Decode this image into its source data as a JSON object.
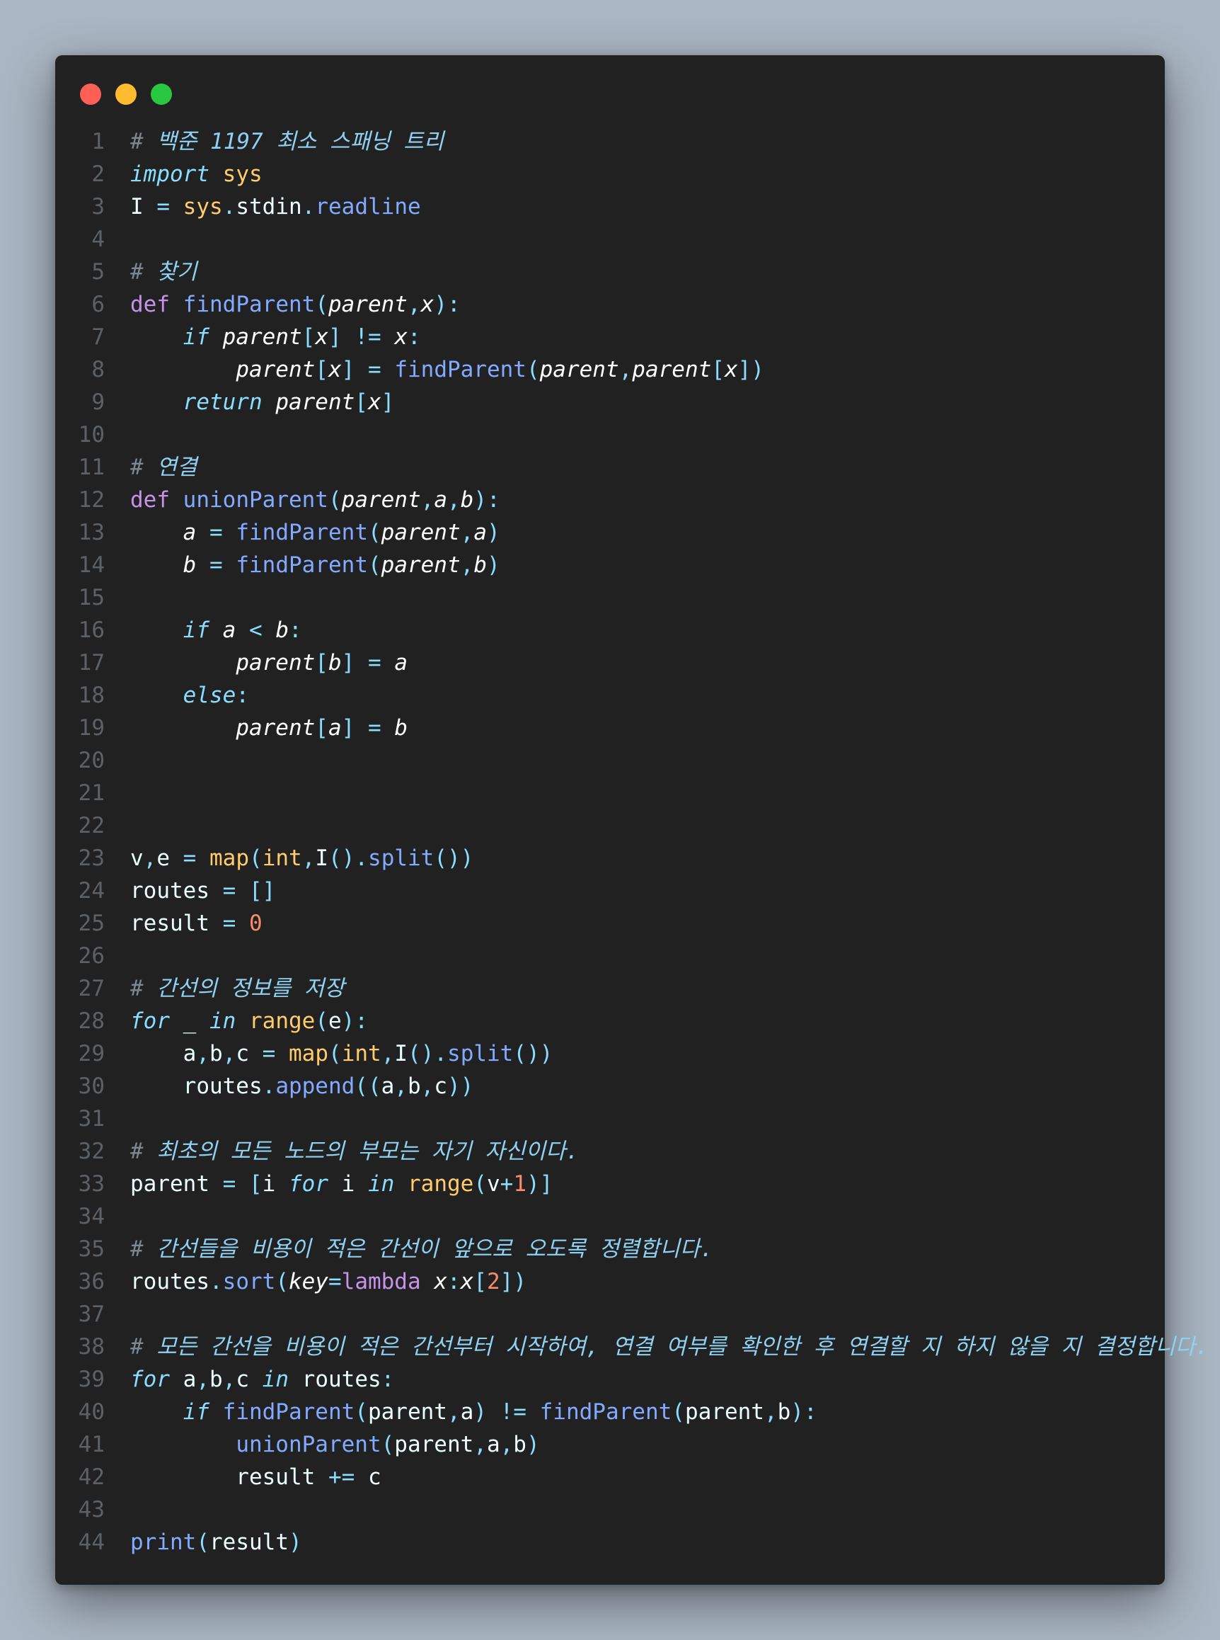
{
  "window_controls": {
    "close_color": "#ff5f57",
    "minimize_color": "#febc2e",
    "maximize_color": "#28c840"
  },
  "code_lines": [
    {
      "n": "1",
      "tokens": [
        {
          "t": "# ",
          "c": "comment"
        },
        {
          "t": "백준 1197 최소 스패닝 트리",
          "c": "ctext"
        }
      ]
    },
    {
      "n": "2",
      "tokens": [
        {
          "t": "import",
          "c": "ctrl"
        },
        {
          "t": " ",
          "c": "plain"
        },
        {
          "t": "sys",
          "c": "builtin"
        }
      ]
    },
    {
      "n": "3",
      "tokens": [
        {
          "t": "I ",
          "c": "plain"
        },
        {
          "t": "=",
          "c": "op"
        },
        {
          "t": " ",
          "c": "plain"
        },
        {
          "t": "sys",
          "c": "builtin"
        },
        {
          "t": ".",
          "c": "op"
        },
        {
          "t": "stdin",
          "c": "plain"
        },
        {
          "t": ".",
          "c": "op"
        },
        {
          "t": "readline",
          "c": "fn"
        }
      ]
    },
    {
      "n": "4",
      "tokens": []
    },
    {
      "n": "5",
      "tokens": [
        {
          "t": "# ",
          "c": "comment"
        },
        {
          "t": "찾기",
          "c": "ctext"
        }
      ]
    },
    {
      "n": "6",
      "tokens": [
        {
          "t": "def",
          "c": "kw"
        },
        {
          "t": " ",
          "c": "plain"
        },
        {
          "t": "findParent",
          "c": "fn"
        },
        {
          "t": "(",
          "c": "op"
        },
        {
          "t": "parent",
          "c": "param"
        },
        {
          "t": ",",
          "c": "op"
        },
        {
          "t": "x",
          "c": "param"
        },
        {
          "t": "):",
          "c": "op"
        }
      ]
    },
    {
      "n": "7",
      "tokens": [
        {
          "t": "    ",
          "c": "plain"
        },
        {
          "t": "if",
          "c": "ctrl"
        },
        {
          "t": " ",
          "c": "plain"
        },
        {
          "t": "parent",
          "c": "param"
        },
        {
          "t": "[",
          "c": "op"
        },
        {
          "t": "x",
          "c": "param"
        },
        {
          "t": "]",
          "c": "op"
        },
        {
          "t": " ",
          "c": "plain"
        },
        {
          "t": "!=",
          "c": "op"
        },
        {
          "t": " ",
          "c": "plain"
        },
        {
          "t": "x",
          "c": "param"
        },
        {
          "t": ":",
          "c": "op"
        }
      ]
    },
    {
      "n": "8",
      "tokens": [
        {
          "t": "        ",
          "c": "plain"
        },
        {
          "t": "parent",
          "c": "param"
        },
        {
          "t": "[",
          "c": "op"
        },
        {
          "t": "x",
          "c": "param"
        },
        {
          "t": "]",
          "c": "op"
        },
        {
          "t": " ",
          "c": "plain"
        },
        {
          "t": "=",
          "c": "op"
        },
        {
          "t": " ",
          "c": "plain"
        },
        {
          "t": "findParent",
          "c": "fn"
        },
        {
          "t": "(",
          "c": "op"
        },
        {
          "t": "parent",
          "c": "param"
        },
        {
          "t": ",",
          "c": "op"
        },
        {
          "t": "parent",
          "c": "param"
        },
        {
          "t": "[",
          "c": "op"
        },
        {
          "t": "x",
          "c": "param"
        },
        {
          "t": "])",
          "c": "op"
        }
      ]
    },
    {
      "n": "9",
      "tokens": [
        {
          "t": "    ",
          "c": "plain"
        },
        {
          "t": "return",
          "c": "ctrl"
        },
        {
          "t": " ",
          "c": "plain"
        },
        {
          "t": "parent",
          "c": "param"
        },
        {
          "t": "[",
          "c": "op"
        },
        {
          "t": "x",
          "c": "param"
        },
        {
          "t": "]",
          "c": "op"
        }
      ]
    },
    {
      "n": "10",
      "tokens": []
    },
    {
      "n": "11",
      "tokens": [
        {
          "t": "# ",
          "c": "comment"
        },
        {
          "t": "연결",
          "c": "ctext"
        }
      ]
    },
    {
      "n": "12",
      "tokens": [
        {
          "t": "def",
          "c": "kw"
        },
        {
          "t": " ",
          "c": "plain"
        },
        {
          "t": "unionParent",
          "c": "fn"
        },
        {
          "t": "(",
          "c": "op"
        },
        {
          "t": "parent",
          "c": "param"
        },
        {
          "t": ",",
          "c": "op"
        },
        {
          "t": "a",
          "c": "param"
        },
        {
          "t": ",",
          "c": "op"
        },
        {
          "t": "b",
          "c": "param"
        },
        {
          "t": "):",
          "c": "op"
        }
      ]
    },
    {
      "n": "13",
      "tokens": [
        {
          "t": "    ",
          "c": "plain"
        },
        {
          "t": "a",
          "c": "param"
        },
        {
          "t": " ",
          "c": "plain"
        },
        {
          "t": "=",
          "c": "op"
        },
        {
          "t": " ",
          "c": "plain"
        },
        {
          "t": "findParent",
          "c": "fn"
        },
        {
          "t": "(",
          "c": "op"
        },
        {
          "t": "parent",
          "c": "param"
        },
        {
          "t": ",",
          "c": "op"
        },
        {
          "t": "a",
          "c": "param"
        },
        {
          "t": ")",
          "c": "op"
        }
      ]
    },
    {
      "n": "14",
      "tokens": [
        {
          "t": "    ",
          "c": "plain"
        },
        {
          "t": "b",
          "c": "param"
        },
        {
          "t": " ",
          "c": "plain"
        },
        {
          "t": "=",
          "c": "op"
        },
        {
          "t": " ",
          "c": "plain"
        },
        {
          "t": "findParent",
          "c": "fn"
        },
        {
          "t": "(",
          "c": "op"
        },
        {
          "t": "parent",
          "c": "param"
        },
        {
          "t": ",",
          "c": "op"
        },
        {
          "t": "b",
          "c": "param"
        },
        {
          "t": ")",
          "c": "op"
        }
      ]
    },
    {
      "n": "15",
      "tokens": []
    },
    {
      "n": "16",
      "tokens": [
        {
          "t": "    ",
          "c": "plain"
        },
        {
          "t": "if",
          "c": "ctrl"
        },
        {
          "t": " ",
          "c": "plain"
        },
        {
          "t": "a",
          "c": "param"
        },
        {
          "t": " ",
          "c": "plain"
        },
        {
          "t": "<",
          "c": "op"
        },
        {
          "t": " ",
          "c": "plain"
        },
        {
          "t": "b",
          "c": "param"
        },
        {
          "t": ":",
          "c": "op"
        }
      ]
    },
    {
      "n": "17",
      "tokens": [
        {
          "t": "        ",
          "c": "plain"
        },
        {
          "t": "parent",
          "c": "param"
        },
        {
          "t": "[",
          "c": "op"
        },
        {
          "t": "b",
          "c": "param"
        },
        {
          "t": "]",
          "c": "op"
        },
        {
          "t": " ",
          "c": "plain"
        },
        {
          "t": "=",
          "c": "op"
        },
        {
          "t": " ",
          "c": "plain"
        },
        {
          "t": "a",
          "c": "param"
        }
      ]
    },
    {
      "n": "18",
      "tokens": [
        {
          "t": "    ",
          "c": "plain"
        },
        {
          "t": "else",
          "c": "ctrl"
        },
        {
          "t": ":",
          "c": "op"
        }
      ]
    },
    {
      "n": "19",
      "tokens": [
        {
          "t": "        ",
          "c": "plain"
        },
        {
          "t": "parent",
          "c": "param"
        },
        {
          "t": "[",
          "c": "op"
        },
        {
          "t": "a",
          "c": "param"
        },
        {
          "t": "]",
          "c": "op"
        },
        {
          "t": " ",
          "c": "plain"
        },
        {
          "t": "=",
          "c": "op"
        },
        {
          "t": " ",
          "c": "plain"
        },
        {
          "t": "b",
          "c": "param"
        }
      ]
    },
    {
      "n": "20",
      "tokens": []
    },
    {
      "n": "21",
      "tokens": []
    },
    {
      "n": "22",
      "tokens": []
    },
    {
      "n": "23",
      "tokens": [
        {
          "t": "v",
          "c": "plain"
        },
        {
          "t": ",",
          "c": "op"
        },
        {
          "t": "e ",
          "c": "plain"
        },
        {
          "t": "=",
          "c": "op"
        },
        {
          "t": " ",
          "c": "plain"
        },
        {
          "t": "map",
          "c": "builtin"
        },
        {
          "t": "(",
          "c": "op"
        },
        {
          "t": "int",
          "c": "builtin"
        },
        {
          "t": ",",
          "c": "op"
        },
        {
          "t": "I",
          "c": "plain"
        },
        {
          "t": "().",
          "c": "op"
        },
        {
          "t": "split",
          "c": "fn"
        },
        {
          "t": "())",
          "c": "op"
        }
      ]
    },
    {
      "n": "24",
      "tokens": [
        {
          "t": "routes ",
          "c": "plain"
        },
        {
          "t": "=",
          "c": "op"
        },
        {
          "t": " ",
          "c": "plain"
        },
        {
          "t": "[]",
          "c": "op"
        }
      ]
    },
    {
      "n": "25",
      "tokens": [
        {
          "t": "result ",
          "c": "plain"
        },
        {
          "t": "=",
          "c": "op"
        },
        {
          "t": " ",
          "c": "plain"
        },
        {
          "t": "0",
          "c": "num"
        }
      ]
    },
    {
      "n": "26",
      "tokens": []
    },
    {
      "n": "27",
      "tokens": [
        {
          "t": "# ",
          "c": "comment"
        },
        {
          "t": "간선의 정보를 저장",
          "c": "ctext"
        }
      ]
    },
    {
      "n": "28",
      "tokens": [
        {
          "t": "for",
          "c": "ctrl"
        },
        {
          "t": " _ ",
          "c": "plain"
        },
        {
          "t": "in",
          "c": "ctrl"
        },
        {
          "t": " ",
          "c": "plain"
        },
        {
          "t": "range",
          "c": "builtin"
        },
        {
          "t": "(",
          "c": "op"
        },
        {
          "t": "e",
          "c": "plain"
        },
        {
          "t": "):",
          "c": "op"
        }
      ]
    },
    {
      "n": "29",
      "tokens": [
        {
          "t": "    a",
          "c": "plain"
        },
        {
          "t": ",",
          "c": "op"
        },
        {
          "t": "b",
          "c": "plain"
        },
        {
          "t": ",",
          "c": "op"
        },
        {
          "t": "c ",
          "c": "plain"
        },
        {
          "t": "=",
          "c": "op"
        },
        {
          "t": " ",
          "c": "plain"
        },
        {
          "t": "map",
          "c": "builtin"
        },
        {
          "t": "(",
          "c": "op"
        },
        {
          "t": "int",
          "c": "builtin"
        },
        {
          "t": ",",
          "c": "op"
        },
        {
          "t": "I",
          "c": "plain"
        },
        {
          "t": "().",
          "c": "op"
        },
        {
          "t": "split",
          "c": "fn"
        },
        {
          "t": "())",
          "c": "op"
        }
      ]
    },
    {
      "n": "30",
      "tokens": [
        {
          "t": "    routes",
          "c": "plain"
        },
        {
          "t": ".",
          "c": "op"
        },
        {
          "t": "append",
          "c": "fn"
        },
        {
          "t": "((",
          "c": "op"
        },
        {
          "t": "a",
          "c": "plain"
        },
        {
          "t": ",",
          "c": "op"
        },
        {
          "t": "b",
          "c": "plain"
        },
        {
          "t": ",",
          "c": "op"
        },
        {
          "t": "c",
          "c": "plain"
        },
        {
          "t": "))",
          "c": "op"
        }
      ]
    },
    {
      "n": "31",
      "tokens": []
    },
    {
      "n": "32",
      "tokens": [
        {
          "t": "# ",
          "c": "comment"
        },
        {
          "t": "최초의 모든 노드의 부모는 자기 자신이다.",
          "c": "ctext"
        }
      ]
    },
    {
      "n": "33",
      "tokens": [
        {
          "t": "parent ",
          "c": "plain"
        },
        {
          "t": "=",
          "c": "op"
        },
        {
          "t": " ",
          "c": "plain"
        },
        {
          "t": "[",
          "c": "op"
        },
        {
          "t": "i ",
          "c": "plain"
        },
        {
          "t": "for",
          "c": "ctrl"
        },
        {
          "t": " i ",
          "c": "plain"
        },
        {
          "t": "in",
          "c": "ctrl"
        },
        {
          "t": " ",
          "c": "plain"
        },
        {
          "t": "range",
          "c": "builtin"
        },
        {
          "t": "(",
          "c": "op"
        },
        {
          "t": "v",
          "c": "plain"
        },
        {
          "t": "+",
          "c": "op"
        },
        {
          "t": "1",
          "c": "num"
        },
        {
          "t": ")]",
          "c": "op"
        }
      ]
    },
    {
      "n": "34",
      "tokens": []
    },
    {
      "n": "35",
      "tokens": [
        {
          "t": "# ",
          "c": "comment"
        },
        {
          "t": "간선들을 비용이 적은 간선이 앞으로 오도록 정렬합니다.",
          "c": "ctext"
        }
      ]
    },
    {
      "n": "36",
      "tokens": [
        {
          "t": "routes",
          "c": "plain"
        },
        {
          "t": ".",
          "c": "op"
        },
        {
          "t": "sort",
          "c": "fn"
        },
        {
          "t": "(",
          "c": "op"
        },
        {
          "t": "key",
          "c": "param"
        },
        {
          "t": "=",
          "c": "op"
        },
        {
          "t": "lambda",
          "c": "kw"
        },
        {
          "t": " ",
          "c": "plain"
        },
        {
          "t": "x",
          "c": "param"
        },
        {
          "t": ":",
          "c": "op"
        },
        {
          "t": "x",
          "c": "param"
        },
        {
          "t": "[",
          "c": "op"
        },
        {
          "t": "2",
          "c": "num"
        },
        {
          "t": "])",
          "c": "op"
        }
      ]
    },
    {
      "n": "37",
      "tokens": []
    },
    {
      "n": "38",
      "tokens": [
        {
          "t": "# ",
          "c": "comment"
        },
        {
          "t": "모든 간선을 비용이 적은 간선부터 시작하여, 연결 여부를 확인한 후 연결할 지 하지 않을 지 결정합니다.",
          "c": "ctext"
        }
      ]
    },
    {
      "n": "39",
      "tokens": [
        {
          "t": "for",
          "c": "ctrl"
        },
        {
          "t": " a",
          "c": "plain"
        },
        {
          "t": ",",
          "c": "op"
        },
        {
          "t": "b",
          "c": "plain"
        },
        {
          "t": ",",
          "c": "op"
        },
        {
          "t": "c ",
          "c": "plain"
        },
        {
          "t": "in",
          "c": "ctrl"
        },
        {
          "t": " routes",
          "c": "plain"
        },
        {
          "t": ":",
          "c": "op"
        }
      ]
    },
    {
      "n": "40",
      "tokens": [
        {
          "t": "    ",
          "c": "plain"
        },
        {
          "t": "if",
          "c": "ctrl"
        },
        {
          "t": " ",
          "c": "plain"
        },
        {
          "t": "findParent",
          "c": "fn"
        },
        {
          "t": "(",
          "c": "op"
        },
        {
          "t": "parent",
          "c": "plain"
        },
        {
          "t": ",",
          "c": "op"
        },
        {
          "t": "a",
          "c": "plain"
        },
        {
          "t": ")",
          "c": "op"
        },
        {
          "t": " ",
          "c": "plain"
        },
        {
          "t": "!=",
          "c": "op"
        },
        {
          "t": " ",
          "c": "plain"
        },
        {
          "t": "findParent",
          "c": "fn"
        },
        {
          "t": "(",
          "c": "op"
        },
        {
          "t": "parent",
          "c": "plain"
        },
        {
          "t": ",",
          "c": "op"
        },
        {
          "t": "b",
          "c": "plain"
        },
        {
          "t": "):",
          "c": "op"
        }
      ]
    },
    {
      "n": "41",
      "tokens": [
        {
          "t": "        ",
          "c": "plain"
        },
        {
          "t": "unionParent",
          "c": "fn"
        },
        {
          "t": "(",
          "c": "op"
        },
        {
          "t": "parent",
          "c": "plain"
        },
        {
          "t": ",",
          "c": "op"
        },
        {
          "t": "a",
          "c": "plain"
        },
        {
          "t": ",",
          "c": "op"
        },
        {
          "t": "b",
          "c": "plain"
        },
        {
          "t": ")",
          "c": "op"
        }
      ]
    },
    {
      "n": "42",
      "tokens": [
        {
          "t": "        result ",
          "c": "plain"
        },
        {
          "t": "+=",
          "c": "op"
        },
        {
          "t": " c",
          "c": "plain"
        }
      ]
    },
    {
      "n": "43",
      "tokens": []
    },
    {
      "n": "44",
      "tokens": [
        {
          "t": "print",
          "c": "fn"
        },
        {
          "t": "(",
          "c": "op"
        },
        {
          "t": "result",
          "c": "plain"
        },
        {
          "t": ")",
          "c": "op"
        }
      ]
    }
  ]
}
